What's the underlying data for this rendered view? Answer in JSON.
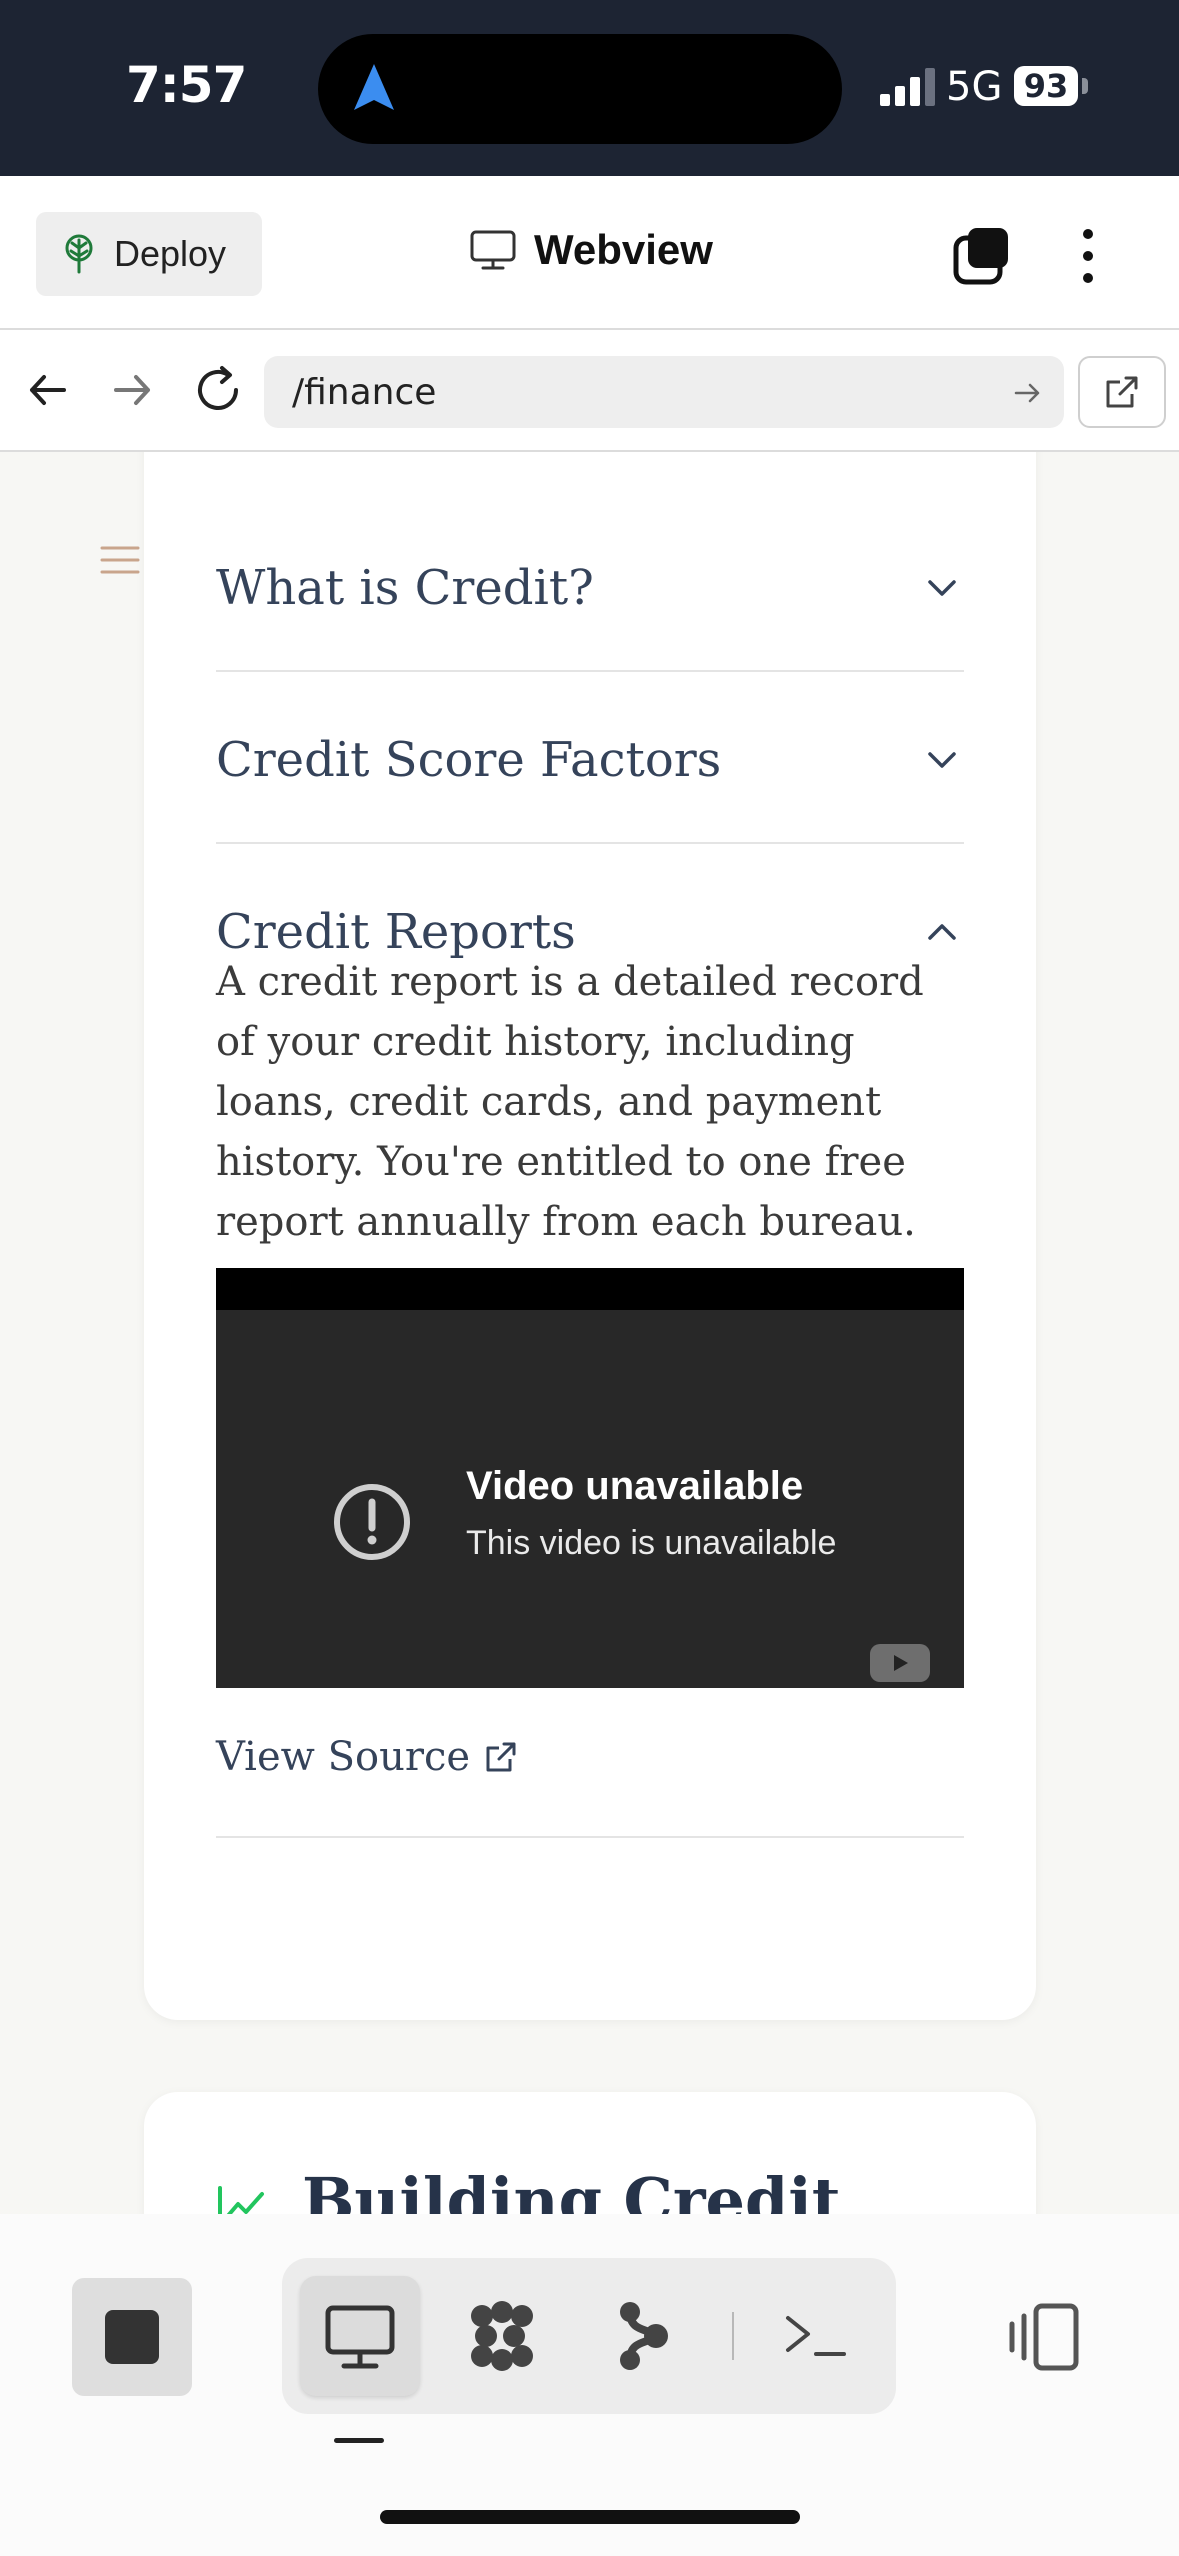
{
  "status_bar": {
    "time": "7:57",
    "network": "5G",
    "battery": "93"
  },
  "toolbar": {
    "deploy_label": "Deploy",
    "title": "Webview"
  },
  "address_bar": {
    "url": "/finance"
  },
  "accordion": {
    "items": [
      {
        "title": "What is Credit?",
        "expanded": false
      },
      {
        "title": "Credit Score Factors",
        "expanded": false
      },
      {
        "title": "Credit Reports",
        "expanded": true
      }
    ],
    "expanded_body": "A credit report is a detailed record of your credit history, including loans, credit cards, and payment history. You're entitled to one free report annually from each bureau."
  },
  "video": {
    "title": "Video unavailable",
    "subtitle": "This video is unavailable"
  },
  "view_source_label": "View Source",
  "next_section": {
    "title": "Building Credit",
    "icon": "trending-up-icon",
    "icon_color": "#22c55e"
  },
  "colors": {
    "status_bg": "#1d2433",
    "heading": "#35435a",
    "accent_blue": "#3b8df0"
  }
}
